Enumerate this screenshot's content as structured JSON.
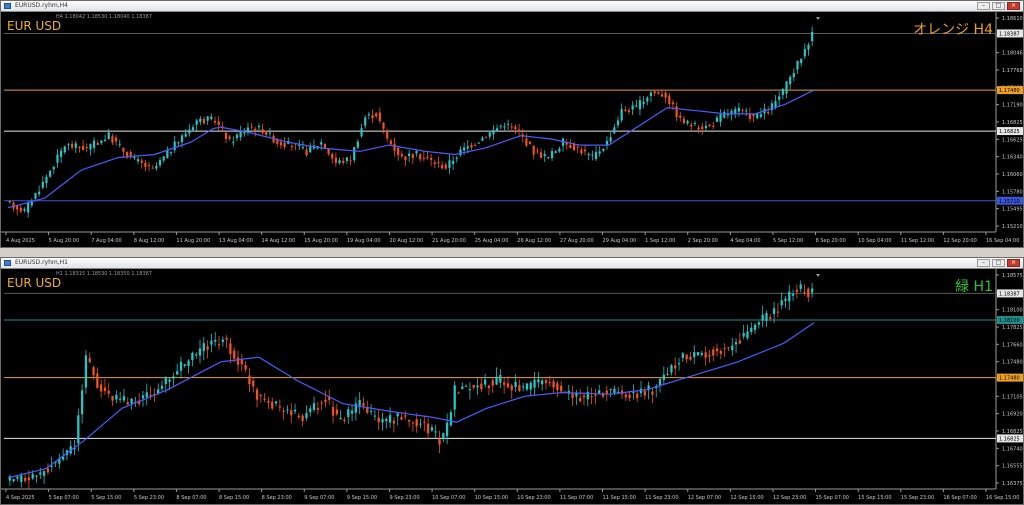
{
  "charts": [
    {
      "window_title": "EURUSD.ryhm,H4",
      "ohlc_header": "H4  1.18042 1.18530 1.18040 1.18387",
      "symbol_label": "EUR USD",
      "overlay_label": "オレンジ H4",
      "overlay_color": "#f0a020",
      "price_ticks": [
        "1.18610",
        "1.18387",
        "1.18046",
        "1.17768",
        "1.17480",
        "1.17190",
        "1.16825",
        "1.16625",
        "1.16340",
        "1.16060",
        "1.15780",
        "1.15495",
        "1.15210"
      ],
      "current_price": "1.18387",
      "time_labels": [
        "4 Aug 2025",
        "5 Aug 20:00",
        "7 Aug 04:00",
        "8 Aug 12:00",
        "11 Aug 20:00",
        "13 Aug 04:00",
        "14 Aug 12:00",
        "15 Aug 20:00",
        "19 Aug 04:00",
        "20 Aug 12:00",
        "21 Aug 20:00",
        "25 Aug 04:00",
        "26 Aug 12:00",
        "27 Aug 20:00",
        "29 Aug 04:00",
        "1 Sep 12:00",
        "2 Sep 20:00",
        "4 Sep 04:00",
        "5 Sep 12:00",
        "8 Sep 20:00",
        "10 Sep 04:00",
        "11 Sep 12:00",
        "12 Sep 20:00",
        "16 Sep 04:00"
      ],
      "hlines": [
        {
          "price": 1.1748,
          "color": "#f0a020",
          "label": "1.17480"
        },
        {
          "price": 1.16825,
          "color": "#e6e6e6",
          "label": "1.16825"
        },
        {
          "price": 1.1571,
          "color": "#3a56d8",
          "label": "1.15710"
        }
      ]
    },
    {
      "window_title": "EURUSD.ryhm,H1",
      "ohlc_header": "H1  1.18315 1.18530 1.18350 1.18387",
      "symbol_label": "EUR USD",
      "overlay_label": "緑 H1",
      "overlay_color": "#2fbf3a",
      "price_ticks": [
        "1.18575",
        "1.18387",
        "1.18100",
        "1.17825",
        "1.17660",
        "1.17480",
        "1.17290",
        "1.17105",
        "1.16920",
        "1.16825",
        "1.16740",
        "1.16555",
        "1.16375"
      ],
      "current_price": "1.18387",
      "time_labels": [
        "4 Sep 2025",
        "5 Sep 07:00",
        "5 Sep 15:00",
        "5 Sep 23:00",
        "8 Sep 07:00",
        "8 Sep 15:00",
        "8 Sep 23:00",
        "9 Sep 07:00",
        "9 Sep 15:00",
        "9 Sep 23:00",
        "10 Sep 07:00",
        "10 Sep 15:00",
        "10 Sep 23:00",
        "11 Sep 07:00",
        "11 Sep 15:00",
        "11 Sep 23:00",
        "12 Sep 07:00",
        "12 Sep 15:00",
        "12 Sep 23:00",
        "15 Sep 07:00",
        "15 Sep 15:00",
        "15 Sep 23:00",
        "16 Sep 07:00",
        "16 Sep 15:00"
      ],
      "hlines": [
        {
          "price": 1.181,
          "color": "#1e8f8a",
          "label": "1.18100"
        },
        {
          "price": 1.1748,
          "color": "#f0a020",
          "label": "1.17480"
        },
        {
          "price": 1.16825,
          "color": "#e6e6e6",
          "label": "1.16825"
        }
      ]
    }
  ],
  "chart_data": [
    {
      "type": "candlestick",
      "timeframe": "H4",
      "symbol": "EURUSD",
      "ylim": [
        1.1521,
        1.1873
      ],
      "x_range": [
        "4 Aug 2025",
        "16 Sep 04:00"
      ],
      "path_points": [
        [
          0,
          1.1568
        ],
        [
          5,
          1.1555
        ],
        [
          10,
          1.16
        ],
        [
          16,
          1.166
        ],
        [
          22,
          1.1655
        ],
        [
          28,
          1.1675
        ],
        [
          34,
          1.164
        ],
        [
          40,
          1.162
        ],
        [
          46,
          1.166
        ],
        [
          52,
          1.17
        ],
        [
          57,
          1.17
        ],
        [
          61,
          1.1665
        ],
        [
          66,
          1.169
        ],
        [
          70,
          1.1685
        ],
        [
          74,
          1.1665
        ],
        [
          78,
          1.166
        ],
        [
          82,
          1.165
        ],
        [
          86,
          1.1665
        ],
        [
          90,
          1.1632
        ],
        [
          94,
          1.1638
        ],
        [
          98,
          1.1705
        ],
        [
          101,
          1.171
        ],
        [
          104,
          1.167
        ],
        [
          108,
          1.164
        ],
        [
          112,
          1.1645
        ],
        [
          116,
          1.1635
        ],
        [
          120,
          1.1625
        ],
        [
          124,
          1.165
        ],
        [
          128,
          1.1665
        ],
        [
          132,
          1.168
        ],
        [
          136,
          1.1695
        ],
        [
          140,
          1.168
        ],
        [
          144,
          1.165
        ],
        [
          148,
          1.164
        ],
        [
          152,
          1.1665
        ],
        [
          156,
          1.1655
        ],
        [
          160,
          1.164
        ],
        [
          164,
          1.1665
        ],
        [
          168,
          1.1715
        ],
        [
          172,
          1.172
        ],
        [
          176,
          1.1745
        ],
        [
          180,
          1.174
        ],
        [
          184,
          1.17
        ],
        [
          188,
          1.169
        ],
        [
          192,
          1.169
        ],
        [
          196,
          1.171
        ],
        [
          200,
          1.1715
        ],
        [
          204,
          1.1705
        ],
        [
          208,
          1.1715
        ],
        [
          212,
          1.1745
        ],
        [
          216,
          1.179
        ],
        [
          220,
          1.1838
        ]
      ],
      "ma_points": [
        [
          0,
          1.156
        ],
        [
          10,
          1.1575
        ],
        [
          20,
          1.162
        ],
        [
          30,
          1.164
        ],
        [
          40,
          1.1645
        ],
        [
          50,
          1.1665
        ],
        [
          57,
          1.169
        ],
        [
          66,
          1.168
        ],
        [
          76,
          1.1665
        ],
        [
          86,
          1.1655
        ],
        [
          96,
          1.165
        ],
        [
          104,
          1.166
        ],
        [
          114,
          1.165
        ],
        [
          122,
          1.1645
        ],
        [
          130,
          1.1655
        ],
        [
          140,
          1.1675
        ],
        [
          148,
          1.167
        ],
        [
          156,
          1.166
        ],
        [
          164,
          1.166
        ],
        [
          172,
          1.169
        ],
        [
          180,
          1.172
        ],
        [
          188,
          1.1715
        ],
        [
          196,
          1.171
        ],
        [
          204,
          1.171
        ],
        [
          212,
          1.1725
        ],
        [
          220,
          1.1748
        ]
      ],
      "horizontal_lines": [
        1.1748,
        1.16825,
        1.1571
      ],
      "last_price": 1.18387
    },
    {
      "type": "candlestick",
      "timeframe": "H1",
      "symbol": "EURUSD",
      "ylim": [
        1.1628,
        1.1865
      ],
      "x_range": [
        "4 Sep 2025",
        "16 Sep 15:00"
      ],
      "path_points": [
        [
          0,
          1.1635
        ],
        [
          8,
          1.1642
        ],
        [
          14,
          1.166
        ],
        [
          18,
          1.1675
        ],
        [
          21,
          1.177
        ],
        [
          24,
          1.174
        ],
        [
          28,
          1.1725
        ],
        [
          34,
          1.1722
        ],
        [
          40,
          1.1735
        ],
        [
          46,
          1.176
        ],
        [
          52,
          1.178
        ],
        [
          57,
          1.179
        ],
        [
          62,
          1.176
        ],
        [
          66,
          1.173
        ],
        [
          72,
          1.1715
        ],
        [
          78,
          1.1705
        ],
        [
          84,
          1.1725
        ],
        [
          88,
          1.17
        ],
        [
          93,
          1.172
        ],
        [
          98,
          1.17
        ],
        [
          104,
          1.1705
        ],
        [
          110,
          1.1698
        ],
        [
          114,
          1.168
        ],
        [
          116,
          1.1695
        ],
        [
          118,
          1.1735
        ],
        [
          124,
          1.174
        ],
        [
          130,
          1.1745
        ],
        [
          136,
          1.1735
        ],
        [
          142,
          1.1745
        ],
        [
          146,
          1.1735
        ],
        [
          152,
          1.1725
        ],
        [
          158,
          1.1735
        ],
        [
          164,
          1.173
        ],
        [
          170,
          1.1735
        ],
        [
          174,
          1.1755
        ],
        [
          178,
          1.177
        ],
        [
          184,
          1.1775
        ],
        [
          190,
          1.178
        ],
        [
          196,
          1.18
        ],
        [
          202,
          1.182
        ],
        [
          208,
          1.1845
        ],
        [
          212,
          1.1838
        ]
      ],
      "ma_points": [
        [
          0,
          1.164
        ],
        [
          10,
          1.165
        ],
        [
          20,
          1.168
        ],
        [
          30,
          1.1715
        ],
        [
          42,
          1.1735
        ],
        [
          56,
          1.1765
        ],
        [
          66,
          1.177
        ],
        [
          76,
          1.1745
        ],
        [
          88,
          1.172
        ],
        [
          100,
          1.1712
        ],
        [
          112,
          1.1705
        ],
        [
          118,
          1.17
        ],
        [
          126,
          1.1715
        ],
        [
          136,
          1.1728
        ],
        [
          146,
          1.1732
        ],
        [
          158,
          1.173
        ],
        [
          168,
          1.1735
        ],
        [
          180,
          1.175
        ],
        [
          192,
          1.1765
        ],
        [
          204,
          1.1785
        ],
        [
          212,
          1.1807
        ]
      ],
      "horizontal_lines": [
        1.181,
        1.1748,
        1.16825
      ],
      "last_price": 1.18387
    }
  ]
}
